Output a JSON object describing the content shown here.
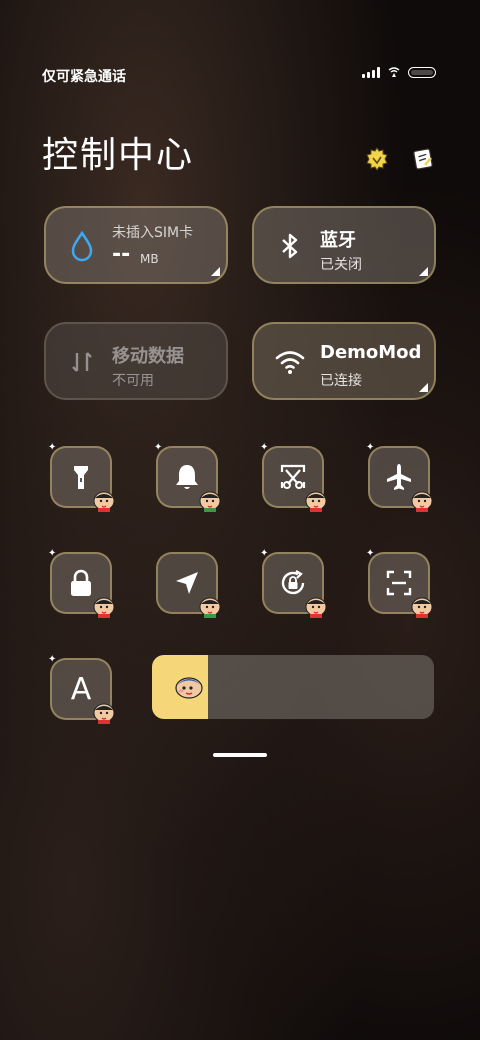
{
  "status_bar": {
    "text": "仅可紧急通话",
    "icons": [
      "signal-icon",
      "wifi-hotspot-icon",
      "battery-icon"
    ]
  },
  "header": {
    "title": "控制中心",
    "icons": [
      "theme-icon",
      "edit-icon"
    ]
  },
  "tiles": [
    {
      "label": "未插入SIM卡",
      "value": "--",
      "unit": "MB",
      "icon": "water-drop-icon"
    },
    {
      "label": "蓝牙",
      "sub": "已关闭",
      "icon": "bluetooth-icon"
    },
    {
      "label": "移动数据",
      "sub": "不可用",
      "icon": "data-arrows-icon"
    },
    {
      "label": "DemoMod",
      "sub": "已连接",
      "icon": "wifi-icon"
    }
  ],
  "toggles": [
    {
      "name": "flashlight",
      "icon": "flashlight-icon"
    },
    {
      "name": "ringer",
      "icon": "bell-icon"
    },
    {
      "name": "screenshot",
      "icon": "screenshot-scissors-icon"
    },
    {
      "name": "airplane-mode",
      "icon": "airplane-icon"
    },
    {
      "name": "lock-screen",
      "icon": "lock-icon"
    },
    {
      "name": "location",
      "icon": "location-arrow-icon"
    },
    {
      "name": "rotation-lock",
      "icon": "rotation-lock-icon"
    },
    {
      "name": "scanner",
      "icon": "scan-icon"
    },
    {
      "name": "auto-brightness",
      "icon": "letter-a-icon",
      "glyph": "A"
    }
  ],
  "brightness": {
    "level": 0.2,
    "fill_color": "#f5d77a"
  },
  "colors": {
    "tile_border": "#c8b478",
    "slider_fill": "#f5d77a"
  }
}
